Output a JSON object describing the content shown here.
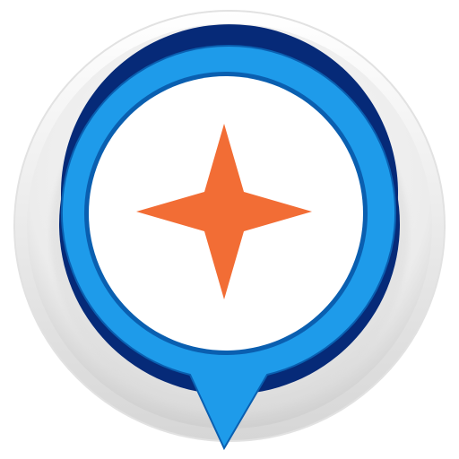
{
  "app_icon": {
    "icon_name": "map-pin-compass-star-icon",
    "colors": {
      "bezel_light": "#fbfbfb",
      "bezel_mid": "#ececec",
      "bezel_dark": "#cfcfcf",
      "pin_blue": "#1e9bea",
      "pin_blue_dark": "#0a5fb0",
      "pin_navy": "#062a78",
      "face": "#ffffff",
      "star": "#f26d35"
    }
  }
}
